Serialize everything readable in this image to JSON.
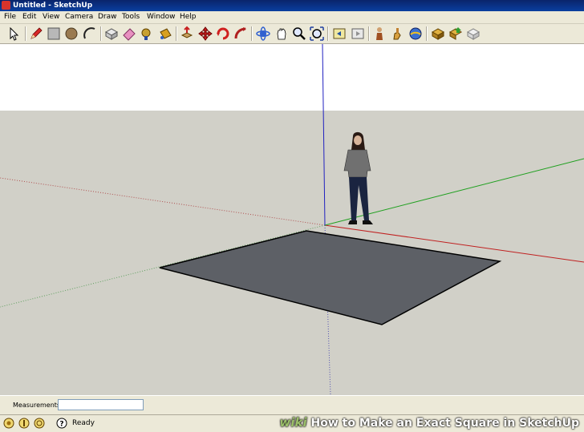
{
  "window": {
    "title": "Untitled - SketchUp"
  },
  "menu": [
    "File",
    "Edit",
    "View",
    "Camera",
    "Draw",
    "Tools",
    "Window",
    "Help"
  ],
  "toolbar": {
    "buttons": [
      "select-icon",
      "pencil-icon",
      "rectangle-icon",
      "circle-icon",
      "arc-icon",
      "make-component-icon",
      "eraser-icon",
      "tape-measure-icon",
      "paint-bucket-icon",
      "push-pull-icon",
      "move-icon",
      "rotate-icon",
      "follow-me-icon",
      "orbit-icon",
      "pan-icon",
      "zoom-icon",
      "zoom-extents-icon",
      "previous-view-icon",
      "next-view-icon",
      "position-camera-icon",
      "walk-icon",
      "look-around-icon",
      "get-models-icon",
      "share-model-icon",
      "share-component-icon"
    ]
  },
  "measurements": {
    "label": "Measurements",
    "value": ""
  },
  "status": {
    "text": "Ready"
  },
  "watermark": {
    "brand": "wiki",
    "text": "How to Make an Exact Square in SketchUp"
  },
  "colors": {
    "sky": "#ffffff",
    "ground": "#d1d0c8",
    "shape_fill": "#5d6066",
    "axis_red": "#c02020",
    "axis_green": "#20a020",
    "axis_blue": "#2020c0"
  }
}
